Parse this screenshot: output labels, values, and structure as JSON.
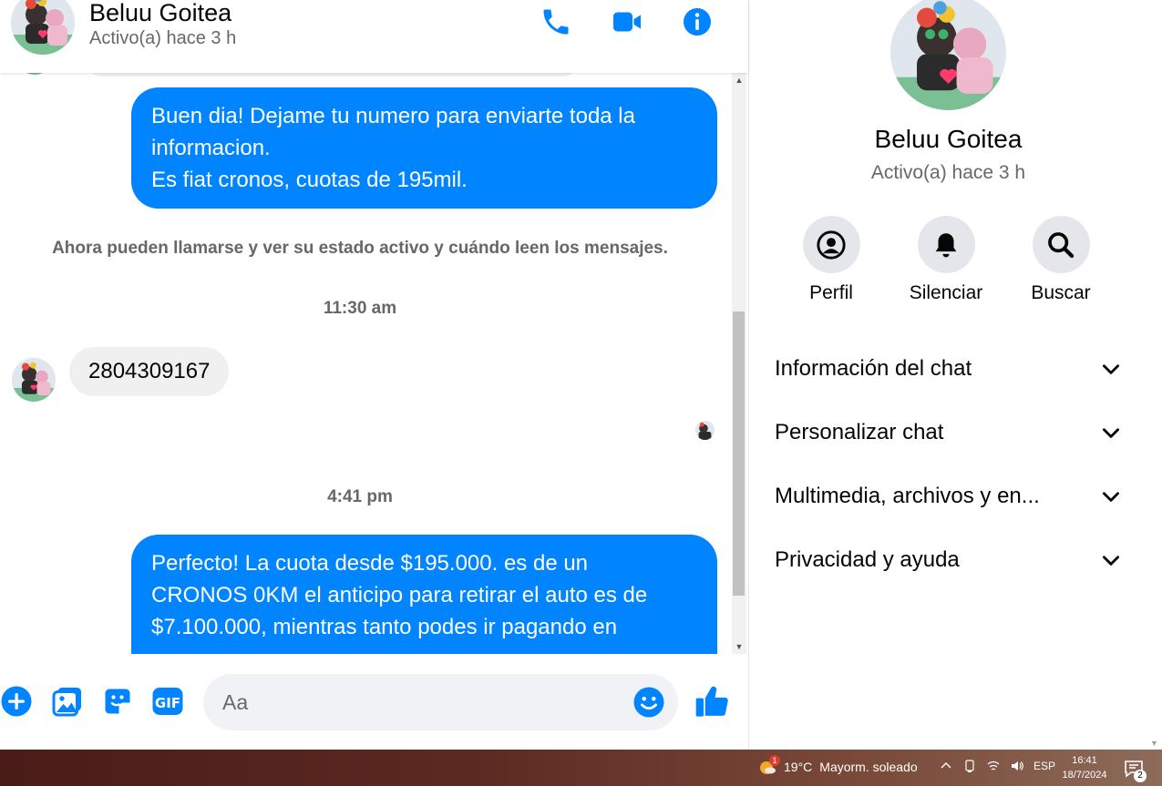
{
  "contact": {
    "name": "Beluu Goitea",
    "status": "Activo(a) hace 3 h"
  },
  "colors": {
    "accent": "#0084ff",
    "incoming_bubble": "#f0f0f0",
    "muted_text": "#65676b"
  },
  "header_icons": [
    "phone-icon",
    "video-camera-icon",
    "info-icon"
  ],
  "messages": {
    "out_1": {
      "lines": [
        "Buen dia! Dejame tu numero para enviarte toda la",
        "informacion.",
        "Es fiat cronos, cuotas de 195mil."
      ]
    },
    "system_note": "Ahora pueden llamarse y ver su estado activo y cuándo leen los mensajes.",
    "time_1": "11:30 am",
    "in_1": "2804309167",
    "time_2": "4:41 pm",
    "out_2": {
      "lines": [
        "Perfecto! La cuota desde $195.000. es de un",
        "CRONOS 0KM el anticipo para retirar el auto es de",
        "$7.100.000, mientras tanto podes ir pagando en"
      ]
    }
  },
  "composer": {
    "placeholder": "Aa",
    "icons": [
      "add-icon",
      "image-icon",
      "sticker-icon",
      "gif-icon",
      "emoji-icon",
      "thumbs-up-icon"
    ]
  },
  "panel": {
    "actions": [
      {
        "label": "Perfil",
        "icon": "profile-icon"
      },
      {
        "label": "Silenciar",
        "icon": "bell-icon"
      },
      {
        "label": "Buscar",
        "icon": "search-icon"
      }
    ],
    "sections": [
      "Información del chat",
      "Personalizar chat",
      "Multimedia, archivos y en...",
      "Privacidad y ayuda"
    ]
  },
  "taskbar": {
    "weather_badge": "1",
    "temperature": "19°C",
    "weather_text": "Mayorm. soleado",
    "language": "ESP",
    "time": "16:41",
    "date": "18/7/2024",
    "notification_count": "2"
  }
}
